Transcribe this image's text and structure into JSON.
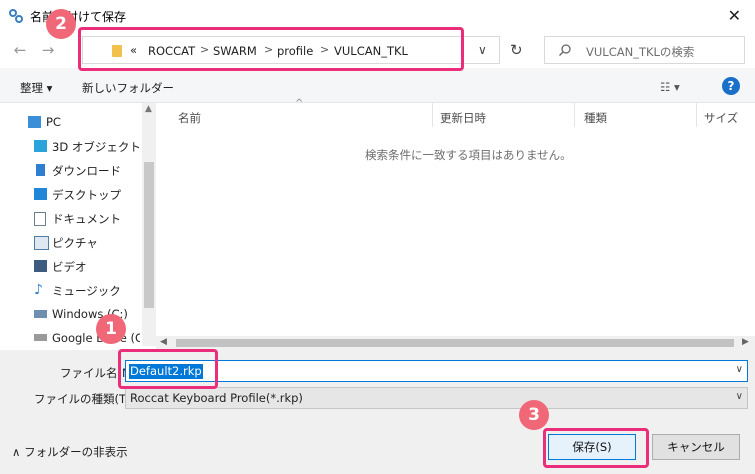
{
  "window": {
    "title": "名前を付けて保存",
    "close": "✕"
  },
  "nav": {
    "back": "←",
    "forward": "→",
    "up": "↑"
  },
  "address": {
    "prefix": "«",
    "crumbs": [
      "ROCCAT",
      "SWARM",
      "profile",
      "VULCAN_TKL"
    ],
    "separator": ">",
    "dropdown": "∨",
    "refresh": "↻"
  },
  "search": {
    "placeholder": "VULCAN_TKLの検索"
  },
  "toolbar": {
    "organize": "整理 ▾",
    "new_folder": "新しいフォルダー",
    "view": "☷ ▾",
    "help": "?"
  },
  "sidebar": {
    "items": [
      {
        "label": "PC",
        "icon": "pc-icon",
        "color": "#3a8fd8"
      },
      {
        "label": "3D オブジェクト",
        "icon": "cube-icon",
        "color": "#29a3d9"
      },
      {
        "label": "ダウンロード",
        "icon": "download-icon",
        "color": "#2f7fd0"
      },
      {
        "label": "デスクトップ",
        "icon": "desktop-icon",
        "color": "#1f86d8"
      },
      {
        "label": "ドキュメント",
        "icon": "document-icon",
        "color": "#6f7f8f"
      },
      {
        "label": "ピクチャ",
        "icon": "picture-icon",
        "color": "#4f7fa8"
      },
      {
        "label": "ビデオ",
        "icon": "video-icon",
        "color": "#3d5a80"
      },
      {
        "label": "ミュージック",
        "icon": "music-icon",
        "color": "#2f7fd0"
      },
      {
        "label": "Windows (C:)",
        "icon": "drive-icon",
        "color": "#6f8fb0"
      },
      {
        "label": "Google Drive (G:",
        "icon": "drive-icon",
        "color": "#7a7a7a"
      }
    ]
  },
  "columns": {
    "name": "名前",
    "modified": "更新日時",
    "type": "種類",
    "size": "サイズ"
  },
  "empty_message": "検索条件に一致する項目はありません。",
  "form": {
    "filename_label": "ファイル名(N):",
    "filename_value": "Default2.rkp",
    "filetype_label": "ファイルの種類(T):",
    "filetype_value": "Roccat Keyboard Profile(*.rkp)"
  },
  "footer": {
    "hide_folders": "∧ フォルダーの非表示",
    "save": "保存(S)",
    "cancel": "キャンセル"
  },
  "markers": {
    "m1": "1",
    "m2": "2",
    "m3": "3"
  },
  "colors": {
    "accent": "#0078d7",
    "marker": "#f06878",
    "highlight": "#ea2e7a"
  }
}
